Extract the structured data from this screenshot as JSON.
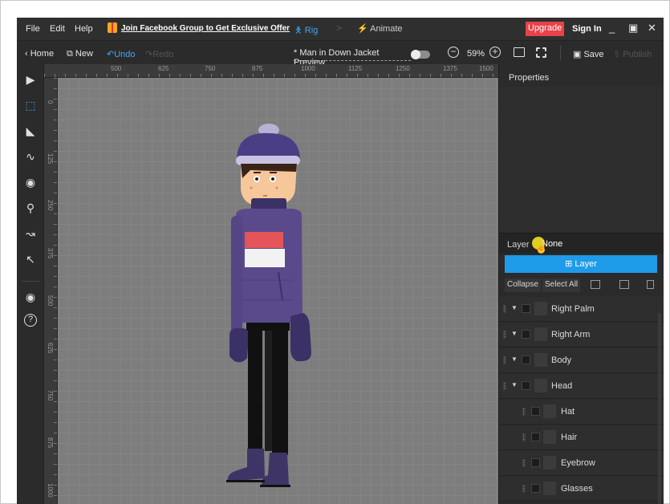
{
  "menubar": {
    "items": [
      "File",
      "Edit",
      "Help"
    ],
    "promo": "Join Facebook Group to Get Exclusive Offer",
    "mode_rig": "Rig",
    "mode_separator": ">",
    "mode_animate": "Animate",
    "upgrade": "Upgrade",
    "sign_in": "Sign In",
    "minimize": "_",
    "maximize": "▣",
    "close": "✕"
  },
  "toolbar": {
    "home": "Home",
    "new": "New",
    "undo": "Undo",
    "redo": "Redo",
    "document_title": "* Man in Down Jacket Preview",
    "zoom_out": "−",
    "zoom_level": "59%",
    "zoom_in": "+",
    "save": "Save",
    "publish": "Publish"
  },
  "rulers": {
    "horizontal": [
      "500",
      "625",
      "750",
      "875",
      "1000",
      "1125",
      "1250",
      "1375",
      "1500"
    ],
    "vertical": [
      "0",
      "125",
      "250",
      "375",
      "500",
      "625",
      "750",
      "875",
      "1000"
    ]
  },
  "tools": [
    {
      "name": "select-arrow-icon",
      "glyph": "▶",
      "active": false
    },
    {
      "name": "bone-select-icon",
      "glyph": "⬚",
      "active": true
    },
    {
      "name": "add-bone-icon",
      "glyph": "◣",
      "active": false
    },
    {
      "name": "curve-bone-icon",
      "glyph": "∿",
      "active": false
    },
    {
      "name": "add-point-icon",
      "glyph": "◉",
      "active": false
    },
    {
      "name": "ik-icon",
      "glyph": "⚲",
      "active": false
    },
    {
      "name": "bend-icon",
      "glyph": "↝",
      "active": false
    },
    {
      "name": "remove-bone-icon",
      "glyph": "↖",
      "active": false
    },
    {
      "name": "visibility-eye-icon",
      "glyph": "◉",
      "active": false
    },
    {
      "name": "help-question-icon",
      "glyph": "?",
      "active": false
    }
  ],
  "panel": {
    "properties_title": "Properties",
    "layer_label": "Layer",
    "layer_value": "None",
    "add_layer": "Layer",
    "collapse": "Collapse",
    "select_all": "Select All",
    "layers": [
      {
        "name": "Right Palm",
        "level": 0,
        "expandable": true
      },
      {
        "name": "Right Arm",
        "level": 0,
        "expandable": true
      },
      {
        "name": "Body",
        "level": 0,
        "expandable": true
      },
      {
        "name": "Head",
        "level": 0,
        "expandable": true
      },
      {
        "name": "Hat",
        "level": 1,
        "expandable": false
      },
      {
        "name": "Hair",
        "level": 1,
        "expandable": false
      },
      {
        "name": "Eyebrow",
        "level": 1,
        "expandable": false
      },
      {
        "name": "Glasses",
        "level": 1,
        "expandable": false
      }
    ]
  },
  "colors": {
    "accent": "#1f9bea",
    "upgrade": "#e8424a",
    "jacket": "#5a4a8c",
    "jacket_stripe_red": "#e4555a",
    "jacket_stripe_white": "#f2f2f2",
    "hat": "#4a3f85",
    "skin": "#f6c79b",
    "pants": "#111111",
    "boots": "#3e3566"
  }
}
